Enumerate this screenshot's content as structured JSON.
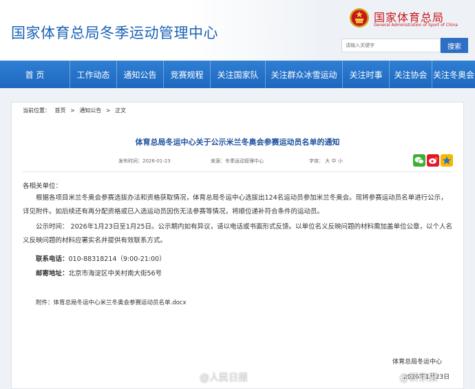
{
  "header": {
    "site_title": "国家体育总局冬季运动管理中心",
    "brand_cn": "国家体育总局",
    "brand_en": "General Administration of Sport of China",
    "search_placeholder": "请输入关键字",
    "search_label": "搜索"
  },
  "nav": {
    "items": [
      {
        "label": "首 页"
      },
      {
        "label": "工作动态"
      },
      {
        "label": "通知公告"
      },
      {
        "label": "竞赛规程"
      },
      {
        "label": "关注国家队"
      },
      {
        "label": "关注群众冰雪运动"
      },
      {
        "label": "关注时事"
      },
      {
        "label": "关注协会"
      },
      {
        "label": "关注冬奥会"
      }
    ]
  },
  "breadcrumb": {
    "prefix": "当前位置：",
    "items": [
      "首页",
      ">",
      "通知公告",
      ">",
      "正文"
    ]
  },
  "article": {
    "title": "体育总局冬运中心关于公示米兰冬奥会参赛运动员名单的通知",
    "publish_time": "发布时间：2026-01-23",
    "source": "来源：冬季运动管理中心",
    "font_size_label": "字体：",
    "font_size_options": [
      "大",
      "中",
      "小"
    ],
    "salutation": "各相关单位：",
    "paragraph_1": "根据各项目米兰冬奥会参赛选拔办法和资格获取情况，体育总局冬运中心选拔出124名运动员参加米兰冬奥会。现将参赛运动员名单进行公示，详见附件。如后续还有再分配资格或已入选运动员因伤无法参赛等情况，将顺位递补符合条件的运动员。",
    "paragraph_2": "公示时间： 2026年1月23日至1月25日。公示期内如有异议，请以电话或书面形式反馈。以单位名义反映问题的材料需加盖单位公章，以个人名义反映问题的材料应署实名并提供有效联系方式。",
    "contact_label": "联系电话：",
    "contact_value": "010-88318214（9:00-21:00）",
    "address_label": "邮寄地址：",
    "address_value": "北京市海淀区中关村南大街56号",
    "attachment": "附件：体育总局冬运中心米兰冬奥会参赛运动员名单.docx",
    "signature_org": "体育总局冬运中心",
    "signature_date": "2026年1月23日"
  },
  "watermarks": {
    "left": "@人民日报",
    "right": "@新京报"
  },
  "colors": {
    "nav_blue": "#2373c9",
    "title_blue": "#1a4f9c",
    "brand_red": "#c8161d",
    "wechat": "#3cb034",
    "weibo": "#e6162d",
    "qzone": "#f5b800"
  }
}
